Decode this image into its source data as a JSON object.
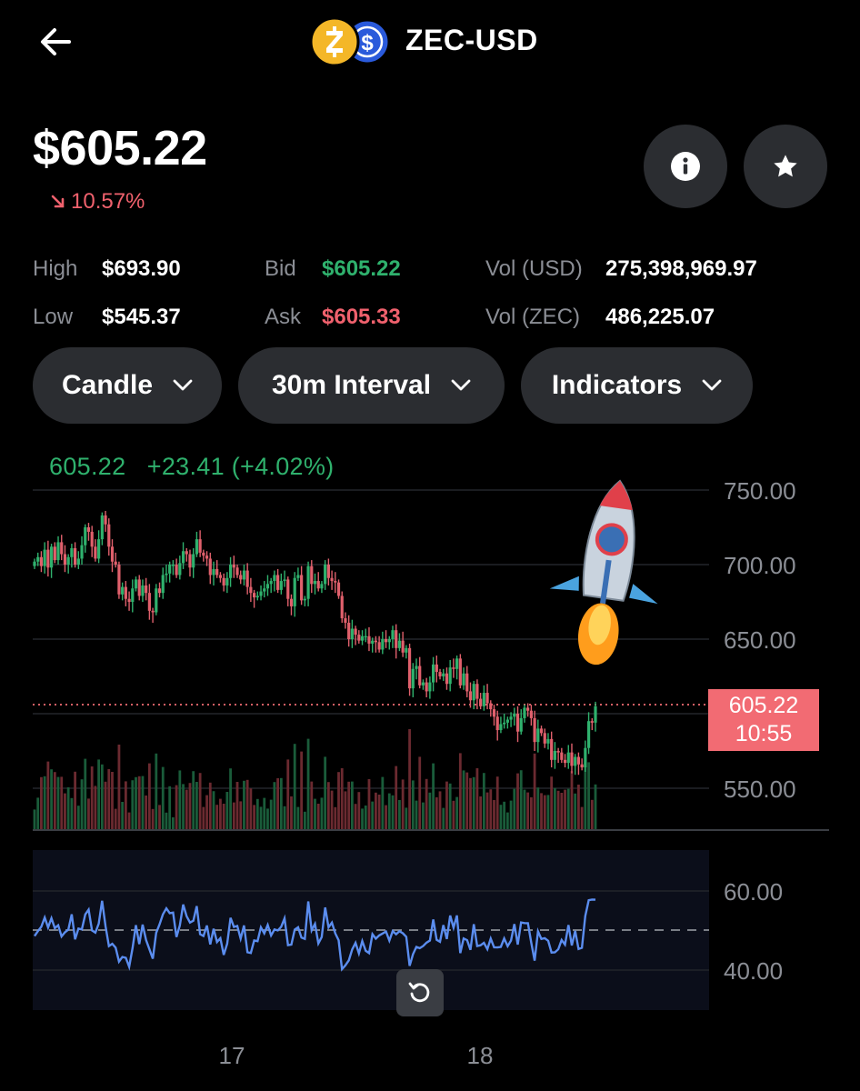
{
  "header": {
    "title": "ZEC-USD",
    "back_icon": "arrow-left-icon",
    "coin_icons": [
      "zec-coin-icon",
      "usd-coin-icon"
    ]
  },
  "summary": {
    "price": "$605.22",
    "change": "10.57%",
    "change_color": "#f0616d"
  },
  "actions": {
    "info_icon": "info-icon",
    "favorite_icon": "star-icon"
  },
  "stats": {
    "high_label": "High",
    "high_value": "$693.90",
    "low_label": "Low",
    "low_value": "$545.37",
    "bid_label": "Bid",
    "bid_value": "$605.22",
    "ask_label": "Ask",
    "ask_value": "$605.33",
    "vol_usd_label": "Vol (USD)",
    "vol_usd_value": "275,398,969.97",
    "vol_zec_label": "Vol (ZEC)",
    "vol_zec_value": "486,225.07"
  },
  "controls": {
    "chart_type": "Candle",
    "interval": "30m Interval",
    "indicators": "Indicators"
  },
  "colors": {
    "up": "#2fb16d",
    "down": "#e0606c",
    "line": "#5b8def",
    "tag": "#f26b73",
    "background": "#000000"
  },
  "chart_data": {
    "type": "candlestick",
    "legend": {
      "price": "605.22",
      "change": "+23.41",
      "change_pct": "(+4.02%)"
    },
    "price_axis": {
      "ticks": [
        "750.00",
        "700.00",
        "650.00",
        "550.00"
      ],
      "ylim": [
        550,
        750
      ],
      "last_price": "605.22",
      "countdown": "10:55"
    },
    "x_ticks": [
      "17",
      "18"
    ],
    "candles_close": [
      702,
      705,
      699,
      710,
      698,
      712,
      703,
      715,
      707,
      700,
      705,
      711,
      700,
      704,
      713,
      725,
      722,
      712,
      704,
      717,
      733,
      727,
      712,
      702,
      700,
      680,
      685,
      677,
      675,
      684,
      690,
      679,
      686,
      681,
      669,
      668,
      684,
      681,
      693,
      694,
      700,
      700,
      693,
      701,
      709,
      707,
      698,
      707,
      717,
      708,
      706,
      704,
      693,
      697,
      693,
      691,
      686,
      691,
      700,
      698,
      693,
      690,
      696,
      685,
      681,
      678,
      679,
      682,
      684,
      687,
      689,
      693,
      683,
      689,
      690,
      677,
      672,
      691,
      693,
      676,
      677,
      699,
      687,
      689,
      684,
      687,
      700,
      691,
      689,
      688,
      679,
      664,
      661,
      650,
      657,
      653,
      649,
      652,
      652,
      647,
      649,
      648,
      643,
      650,
      648,
      650,
      656,
      644,
      649,
      641,
      644,
      617,
      630,
      632,
      619,
      621,
      615,
      621,
      633,
      628,
      625,
      627,
      620,
      631,
      630,
      637,
      619,
      627,
      615,
      609,
      620,
      610,
      605,
      614,
      607,
      603,
      598,
      589,
      593,
      594,
      596,
      598,
      600,
      588,
      597,
      604,
      602,
      597,
      581,
      590,
      587,
      580,
      583,
      569,
      575,
      574,
      569,
      567,
      574,
      565,
      571,
      566,
      564,
      577,
      595,
      594,
      605
    ],
    "volume_note": "volume bars rendered in lower chart band",
    "rsi": {
      "ticks": [
        "60.00",
        "40.00"
      ],
      "ylim": [
        30,
        70
      ],
      "midline": 50
    },
    "reset_icon": "rotate-ccw-icon",
    "rocket_icon": "rocket-icon"
  }
}
